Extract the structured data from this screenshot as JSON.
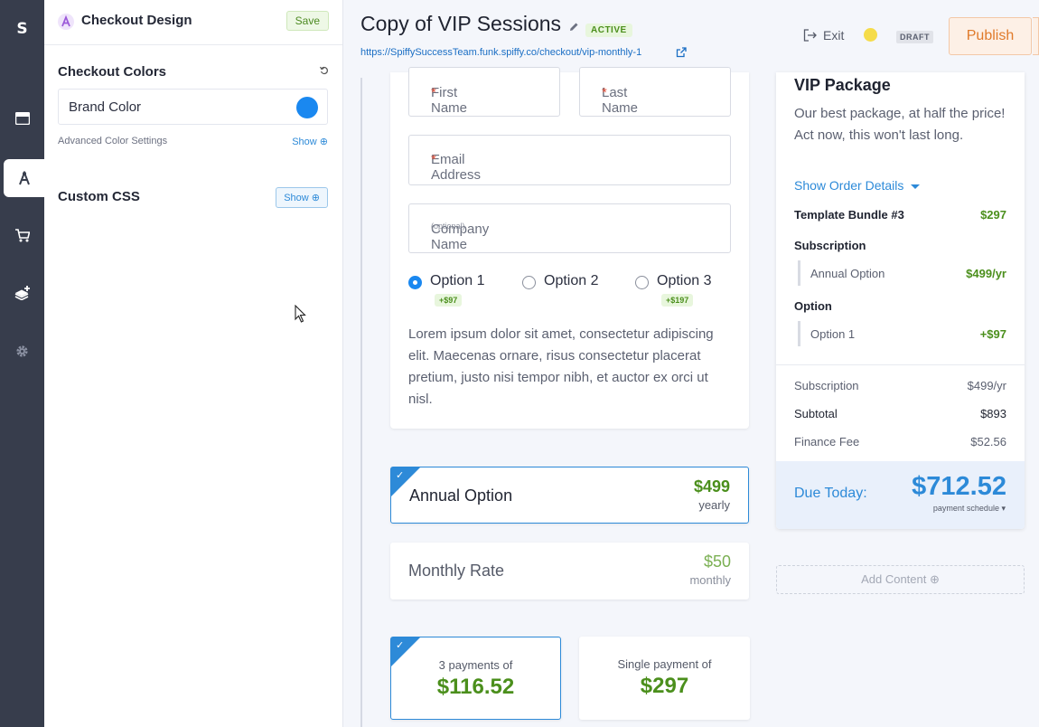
{
  "rail": {
    "logo": "S"
  },
  "panel": {
    "title": "Checkout Design",
    "save_label": "Save",
    "colors_title": "Checkout Colors",
    "brand_color_label": "Brand Color",
    "brand_color": "#1a88f0",
    "advanced_label": "Advanced Color Settings",
    "advanced_show": "Show",
    "custom_css_title": "Custom CSS",
    "custom_css_show": "Show"
  },
  "header": {
    "title": "Copy of VIP Sessions",
    "status": "ACTIVE",
    "url": "https://SpiffySuccessTeam.funk.spiffy.co/checkout/vip-monthly-1",
    "exit_label": "Exit",
    "draft_label": "DRAFT",
    "publish_label": "Publish"
  },
  "form": {
    "first_name": "First Name",
    "last_name": "Last Name",
    "email": "Email Address",
    "company": "Company Name",
    "company_hint": "(optional)",
    "required_mark": "*",
    "options": [
      {
        "label": "Option 1",
        "price": "+$97",
        "selected": true
      },
      {
        "label": "Option 2",
        "price": "",
        "selected": false
      },
      {
        "label": "Option 3",
        "price": "+$197",
        "selected": false
      }
    ],
    "description": "Lorem ipsum dolor sit amet, consectetur adipiscing elit. Maecenas ornare, risus consectetur placerat pretium, justo nisi tempor nibh, et auctor ex orci ut nisl."
  },
  "plans": [
    {
      "name": "Annual Option",
      "price": "$499",
      "period": "yearly",
      "selected": true
    },
    {
      "name": "Monthly Rate",
      "price": "$50",
      "period": "monthly",
      "selected": false
    }
  ],
  "payments": [
    {
      "label": "3 payments of",
      "amount": "$116.52",
      "selected": true
    },
    {
      "label": "Single payment of",
      "amount": "$297",
      "selected": false
    }
  ],
  "summary": {
    "title": "VIP Package",
    "description": "Our best package, at half the price! Act now, this won't last long.",
    "toggle": "Show Order Details",
    "bundle_label": "Template Bundle #3",
    "bundle_price": "$297",
    "subscription_heading": "Subscription",
    "subscription_item": "Annual Option",
    "subscription_item_price": "$499/yr",
    "option_heading": "Option",
    "option_item": "Option 1",
    "option_item_price": "+$97",
    "subscription_label": "Subscription",
    "subscription_value": "$499/yr",
    "subtotal_label": "Subtotal",
    "subtotal_value": "$893",
    "finance_label": "Finance Fee",
    "finance_value": "$52.56",
    "due_label": "Due Today:",
    "due_amount": "$712.52",
    "schedule_label": "payment schedule"
  },
  "add_content_label": "Add Content",
  "colors": {
    "accent": "#2d8ad8",
    "green": "#4b8f1c",
    "publish": "#e07a2a"
  }
}
